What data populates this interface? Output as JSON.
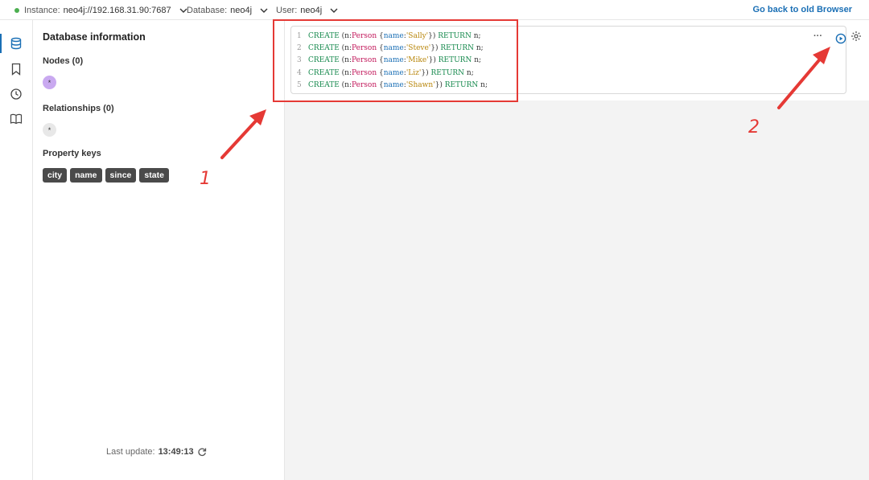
{
  "topbar": {
    "instance_label": "Instance:",
    "instance_value": "neo4j://192.168.31.90:7687",
    "database_label": "Database:",
    "database_value": "neo4j",
    "user_label": "User:",
    "user_value": "neo4j",
    "back_link": "Go back to old Browser"
  },
  "sidebar": {
    "title": "Database information",
    "nodes_heading": "Nodes (0)",
    "nodes_chip": "*",
    "relationships_heading": "Relationships (0)",
    "relationships_chip": "*",
    "property_keys_heading": "Property keys",
    "property_keys": [
      "city",
      "name",
      "since",
      "state"
    ],
    "last_update_label": "Last update:",
    "last_update_time": "13:49:13"
  },
  "editor": {
    "lines": [
      {
        "n": "1",
        "name": "'Sally'"
      },
      {
        "n": "2",
        "name": "'Steve'"
      },
      {
        "n": "3",
        "name": "'Mike'"
      },
      {
        "n": "4",
        "name": "'Liz'"
      },
      {
        "n": "5",
        "name": "'Shawn'"
      }
    ],
    "tokens": {
      "create": "CREATE",
      "open": " (n:",
      "label": "Person",
      "brace_open": " {",
      "prop": "name",
      "colon": ":",
      "close": "})",
      "return_kw": " RETURN",
      "tail": " n;"
    },
    "more_label": "···"
  },
  "annotations": {
    "step1": "1",
    "step2": "2"
  },
  "colors": {
    "accent": "#1a6fb5",
    "annotation": "#e53935",
    "status_connected": "#4caf50",
    "node_chip": "#c9a9f0"
  }
}
